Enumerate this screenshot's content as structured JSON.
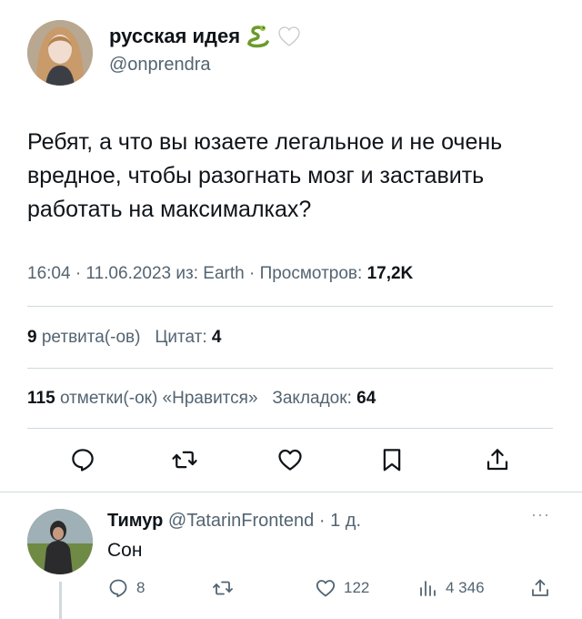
{
  "tweet": {
    "author_name": "русская идея",
    "author_handle": "@onprendra",
    "emoji_icons": [
      "snake-icon",
      "white-heart-icon"
    ],
    "text": "Ребят, а что вы юзаете легальное и не очень вредное, чтобы разогнать мозг и заставить работать на максималках?",
    "meta_time": "16:04 · 11.06.2023 из: Earth · Просмотров:",
    "meta_views": "17,2K",
    "retweets_count": "9",
    "retweets_label": "ретвита(-ов)",
    "quotes_label": "Цитат:",
    "quotes_count": "4",
    "likes_count": "115",
    "likes_label": "отметки(-ок) «Нравится»",
    "bookmarks_label": "Закладок:",
    "bookmarks_count": "64",
    "actions": [
      "reply-icon",
      "retweet-icon",
      "like-icon",
      "bookmark-icon",
      "share-icon"
    ]
  },
  "reply": {
    "author_name": "Тимур",
    "author_handle": "@TatarinFrontend",
    "age": "· 1 д.",
    "more": "···",
    "text": "Сон",
    "replies_count": "8",
    "likes_count": "122",
    "views_count": "4 346"
  },
  "colors": {
    "text": "#0f1419",
    "secondary": "#536471",
    "divider": "#cfd9de"
  }
}
